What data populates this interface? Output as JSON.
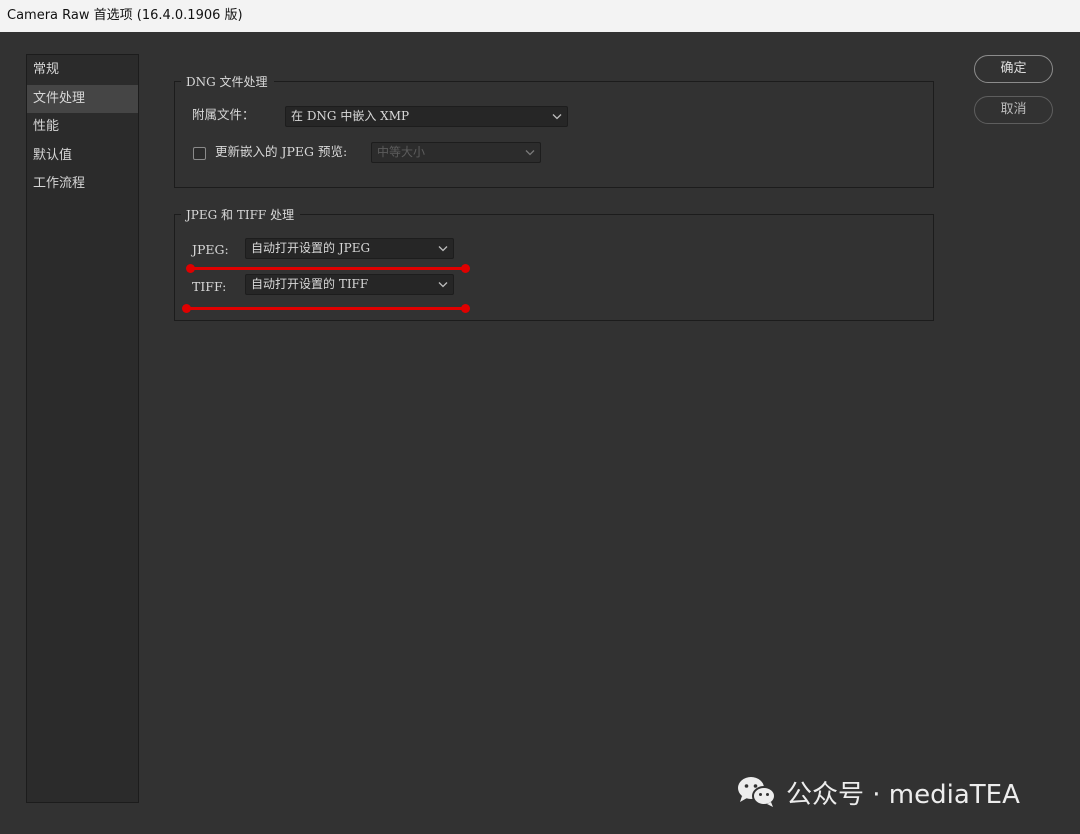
{
  "window": {
    "title": "Camera Raw 首选项 (16.4.0.1906 版)"
  },
  "sidebar": {
    "items": [
      {
        "label": "常规"
      },
      {
        "label": "文件处理",
        "active": true
      },
      {
        "label": "性能"
      },
      {
        "label": "默认值"
      },
      {
        "label": "工作流程"
      }
    ]
  },
  "dng_group": {
    "title": "DNG 文件处理",
    "sidecar_label": "附属文件：",
    "sidecar_value": "在 DNG 中嵌入 XMP",
    "update_jpeg_label": "更新嵌入的 JPEG 预览:",
    "update_jpeg_checked": false,
    "preview_size_value": "中等大小"
  },
  "jpeg_tiff_group": {
    "title": "JPEG 和 TIFF 处理",
    "jpeg_label": "JPEG:",
    "jpeg_value": "自动打开设置的 JPEG",
    "tiff_label": "TIFF:",
    "tiff_value": "自动打开设置的 TIFF"
  },
  "buttons": {
    "ok": "确定",
    "cancel": "取消"
  },
  "annotations": {
    "highlight_color": "#e00000"
  },
  "watermark": {
    "icon": "wechat-icon",
    "text": "公众号 · mediaTEA"
  },
  "colors": {
    "background": "#323232",
    "panel": "#2b2b2b",
    "titlebar": "#f3f3f3"
  }
}
